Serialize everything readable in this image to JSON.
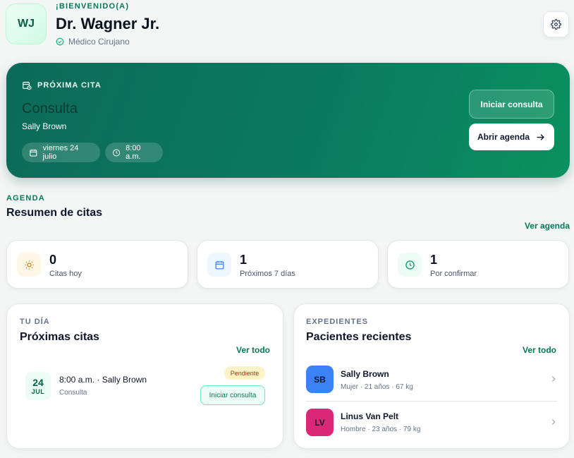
{
  "header": {
    "initials": "WJ",
    "welcome": "¡BIENVENIDO(A)",
    "name": "Dr. Wagner Jr.",
    "role": "Médico Cirujano"
  },
  "next_appointment": {
    "label": "PRÓXIMA CITA",
    "type": "Consulta",
    "patient": "Sally Brown",
    "date": "viernes 24 julio",
    "time": "8:00 a.m.",
    "start_button": "Iniciar consulta",
    "agenda_button": "Abrir agenda"
  },
  "agenda": {
    "kicker": "AGENDA",
    "title": "Resumen de citas",
    "link": "Ver agenda",
    "stats": [
      {
        "value": "0",
        "label": "Citas hoy",
        "icon": "sun-icon"
      },
      {
        "value": "1",
        "label": "Próximos 7 días",
        "icon": "calendar-icon"
      },
      {
        "value": "1",
        "label": "Por confirmar",
        "icon": "clock-icon"
      }
    ]
  },
  "today": {
    "kicker": "TU DÍA",
    "title": "Próximas citas",
    "link": "Ver todo",
    "items": [
      {
        "day": "24",
        "month": "JUL",
        "title": "8:00 a.m. · Sally Brown",
        "subtitle": "Consulta",
        "status": "Pendiente",
        "action": "Iniciar consulta"
      }
    ]
  },
  "records": {
    "kicker": "EXPEDIENTES",
    "title": "Pacientes recientes",
    "link": "Ver todo",
    "patients": [
      {
        "initials": "SB",
        "name": "Sally Brown",
        "meta": "Mujer · 21 años · 67 kg",
        "color": "#3b82f6"
      },
      {
        "initials": "LV",
        "name": "Linus Van Pelt",
        "meta": "Hombre · 23 años · 79 kg",
        "color": "#db2777"
      }
    ]
  },
  "colors": {
    "brand": "#047857",
    "hero_start": "#0c6a58",
    "hero_end": "#0b915f"
  }
}
